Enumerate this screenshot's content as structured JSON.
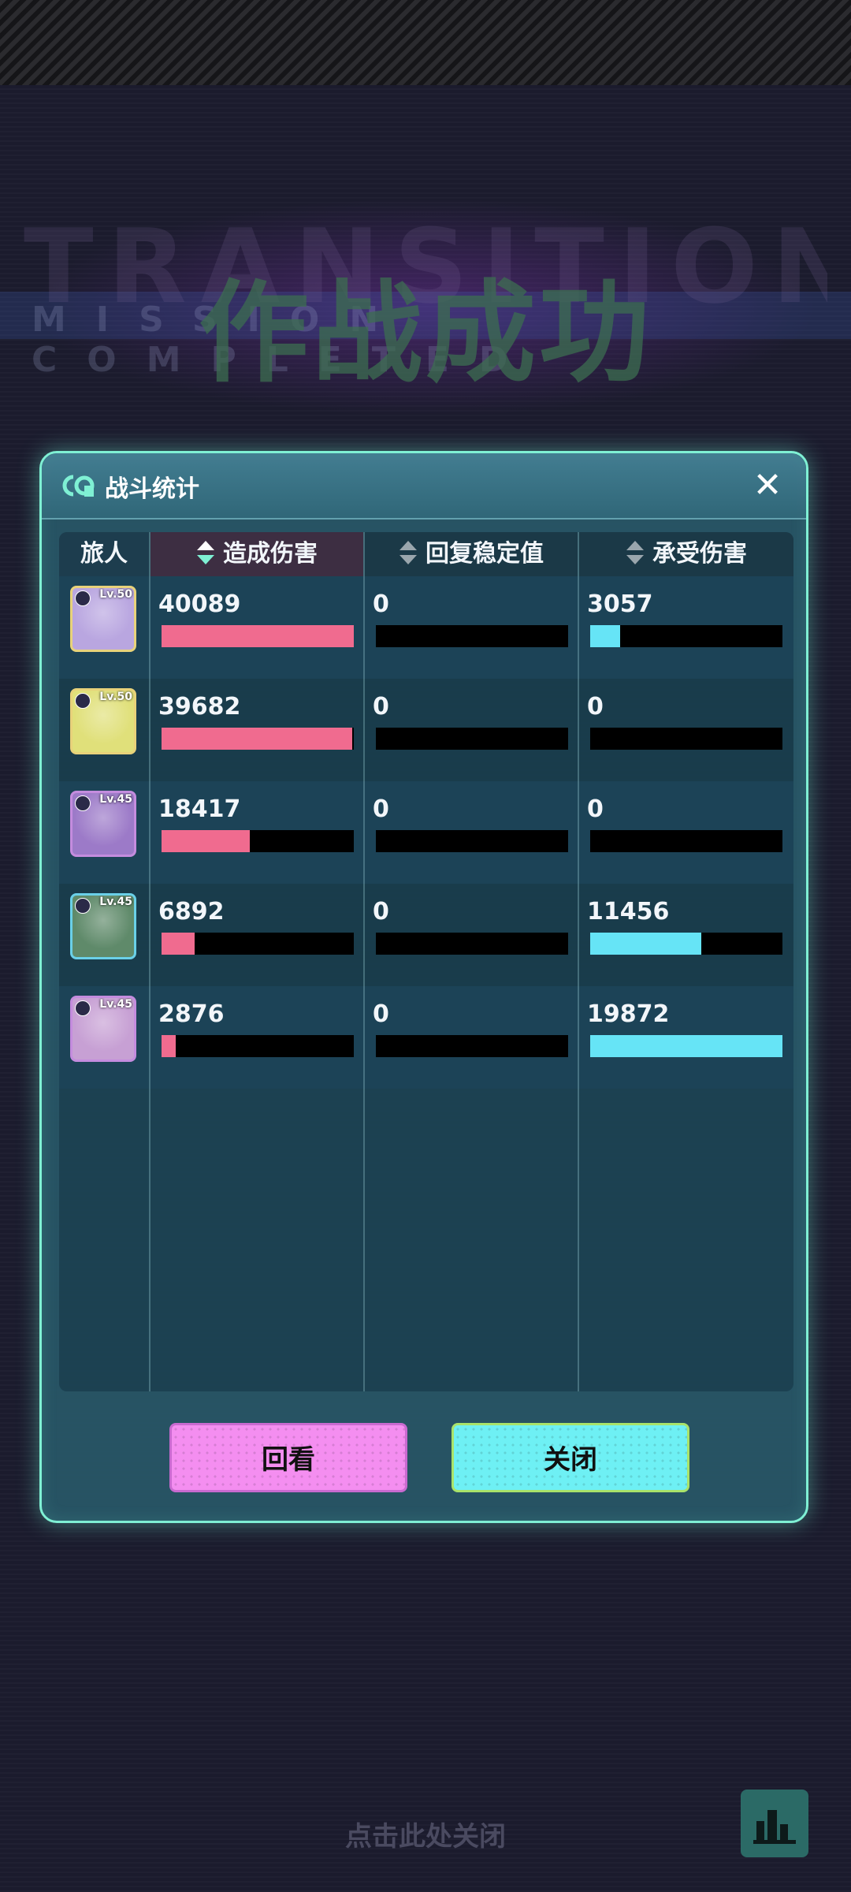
{
  "background": {
    "watermark": "TRANSITION",
    "subtitle": "MISSION COMPLETED",
    "title": "作战成功"
  },
  "panel": {
    "title": "战斗统计",
    "close_icon": "close-icon"
  },
  "table": {
    "headers": {
      "traveler": "旅人",
      "damage_dealt": "造成伤害",
      "stability_restored": "回复稳定值",
      "damage_taken": "承受伤害"
    },
    "rows": [
      {
        "level": "Lv.50",
        "damage_dealt": "40089",
        "damage_pct": 1.0,
        "stability": "0",
        "stability_pct": 0,
        "taken": "3057",
        "taken_pct": 0.154,
        "avatar_bg": "#b9a6e0",
        "border": "#e8d27a"
      },
      {
        "level": "Lv.50",
        "damage_dealt": "39682",
        "damage_pct": 0.99,
        "stability": "0",
        "stability_pct": 0,
        "taken": "0",
        "taken_pct": 0,
        "avatar_bg": "#e0e07a",
        "border": "#e8d27a"
      },
      {
        "level": "Lv.45",
        "damage_dealt": "18417",
        "damage_pct": 0.46,
        "stability": "0",
        "stability_pct": 0,
        "taken": "0",
        "taken_pct": 0,
        "avatar_bg": "#9c7ac8",
        "border": "#c48cde"
      },
      {
        "level": "Lv.45",
        "damage_dealt": "6892",
        "damage_pct": 0.172,
        "stability": "0",
        "stability_pct": 0,
        "taken": "11456",
        "taken_pct": 0.577,
        "avatar_bg": "#5f8a6a",
        "border": "#6ad0e8"
      },
      {
        "level": "Lv.45",
        "damage_dealt": "2876",
        "damage_pct": 0.072,
        "stability": "0",
        "stability_pct": 0,
        "taken": "19872",
        "taken_pct": 1.0,
        "avatar_bg": "#c7a0d4",
        "border": "#c48cde"
      }
    ]
  },
  "buttons": {
    "replay": "回看",
    "close": "关闭"
  },
  "footer": {
    "tap_to_close": "点击此处关闭",
    "stats_icon": "bar-chart-icon"
  },
  "colors": {
    "accent": "#7ff0d4",
    "damage_bar": "#f06b8f",
    "taken_bar": "#66e4f6"
  }
}
